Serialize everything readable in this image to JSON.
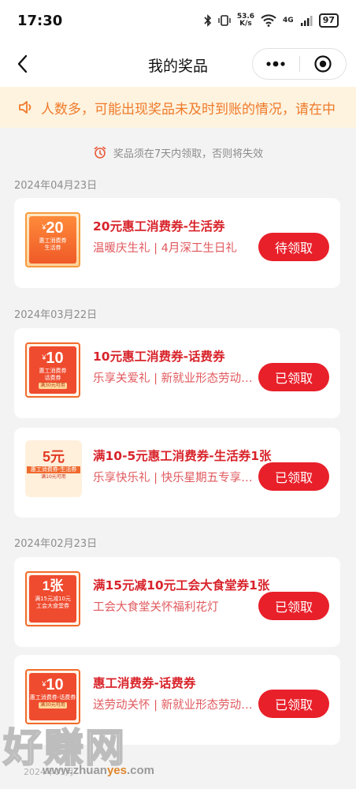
{
  "status_bar": {
    "time": "17:30",
    "net_speed_value": "53.6",
    "net_speed_unit": "K/s",
    "network": "4G",
    "battery": "97"
  },
  "nav": {
    "title": "我的奖品",
    "back_icon": "chevron-left-icon",
    "more_icon": "more-dots-icon",
    "target_icon": "record-icon"
  },
  "notice": {
    "icon": "speaker-icon",
    "text": "人数多，可能出现奖品未及时到账的情况，请在中"
  },
  "tip": {
    "icon": "alarm-clock-icon",
    "text": "奖品须在7天内领取，否则将失效"
  },
  "groups": [
    {
      "date": "2024年04月23日"
    },
    {
      "date": "2024年03月22日"
    },
    {
      "date": "2024年02月23日"
    }
  ],
  "prizes": [
    {
      "coupon_value": "20",
      "coupon_prefix": "¥",
      "coupon_line1": "惠工消费券",
      "coupon_line2": "生活券",
      "coupon_tag": "",
      "title": "20元惠工消费券-生活券",
      "subtitle": "温暖庆生礼 | 4月深工生日礼",
      "button": "待领取"
    },
    {
      "coupon_value": "10",
      "coupon_prefix": "¥",
      "coupon_line1": "惠工消费券",
      "coupon_line2": "话费券",
      "coupon_tag": "满30元可用",
      "title": "10元惠工消费券-话费券",
      "subtitle": "乐享关爱礼 | 新就业形态劳动者关爱",
      "button": "已领取"
    },
    {
      "coupon_value": "5元",
      "coupon_prefix": "",
      "coupon_line1": "惠工消费券-生活券",
      "coupon_line2": "",
      "coupon_tag": "满10元可用",
      "title": "满10-5元惠工消费券-生活券1张",
      "subtitle": "乐享快乐礼 | 快乐星期五专享福利",
      "button": "已领取"
    },
    {
      "coupon_value": "1张",
      "coupon_prefix": "",
      "coupon_line1": "满15元减10元",
      "coupon_line2": "工会大食堂券",
      "coupon_tag": "",
      "title": "满15元减10元工会大食堂券1张",
      "subtitle": "工会大食堂关怀福利花灯",
      "button": "已领取"
    },
    {
      "coupon_value": "10",
      "coupon_prefix": "¥",
      "coupon_line1": "惠工消费券-话费券",
      "coupon_line2": "",
      "coupon_tag": "满30元可用",
      "title": "惠工消费券-话费券",
      "subtitle": "送劳动关怀 | 新就业形态劳动者关爱",
      "button": "已领取"
    }
  ],
  "watermark": {
    "big": "好赚网",
    "url_prefix": "www.zhuan",
    "url_accent": "yes",
    "url_suffix": ".com",
    "faint": "2024年01月"
  },
  "colors": {
    "accent_red": "#e8202a",
    "title_red": "#d8232a",
    "notice_orange": "#f07a2a",
    "notice_bg": "#fdf3df"
  }
}
